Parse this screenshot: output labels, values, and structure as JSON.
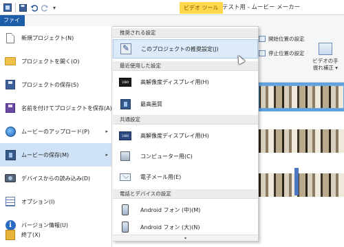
{
  "titlebar": {
    "quick_access": [
      "app-icon",
      "save-icon",
      "undo-icon",
      "redo-icon",
      "dropdown-icon"
    ],
    "context_tab": "ビデオ ツール",
    "app_title": "テスト用 - ムービー メーカー"
  },
  "ribbon": {
    "file_tab": "ファイル",
    "set_start_point": "開始位置の設定",
    "set_end_point": "停止位置の設定",
    "stabilization_line1": "ビデオの手",
    "stabilization_line2": "振れ補正 ▾"
  },
  "file_menu": {
    "items": [
      {
        "label": "新規プロジェクト(N)",
        "icon": "new-project-icon",
        "submenu": false
      },
      {
        "label": "プロジェクトを開く(O)",
        "icon": "open-folder-icon",
        "submenu": false
      },
      {
        "label": "プロジェクトの保存(S)",
        "icon": "save-icon",
        "submenu": false
      },
      {
        "label": "名前を付けてプロジェクトを保存(A)",
        "icon": "save-as-icon",
        "submenu": false
      },
      {
        "label": "ムービーのアップロード(P)",
        "icon": "upload-globe-icon",
        "submenu": true
      },
      {
        "label": "ムービーの保存(M)",
        "icon": "save-movie-icon",
        "submenu": true,
        "active": true
      },
      {
        "label": "デバイスからの読み込み(D)",
        "icon": "camera-import-icon",
        "submenu": false
      },
      {
        "label": "オプション(I)",
        "icon": "options-icon",
        "submenu": false
      },
      {
        "label": "バージョン情報(U)",
        "icon": "info-icon",
        "submenu": false
      },
      {
        "label": "終了(X)",
        "icon": "exit-icon",
        "submenu": false
      }
    ]
  },
  "save_submenu": {
    "section_recommended": "推奨される設定",
    "recommended_item": "このプロジェクトの推奨設定(J)",
    "section_recent": "最近使用した設定",
    "recent_items": [
      "高解像度ディスプレイ用(H)",
      "最高画質"
    ],
    "section_common": "共通設定",
    "common_items": [
      "高解像度ディスプレイ用(H)",
      "コンピューター用(C)",
      "電子メール用(E)"
    ],
    "section_devices": "電話とデバイスの設定",
    "device_items": [
      "Android フォン (中)(M)",
      "Android フォン (大)(N)"
    ],
    "scroll_down_icon": "▾"
  }
}
